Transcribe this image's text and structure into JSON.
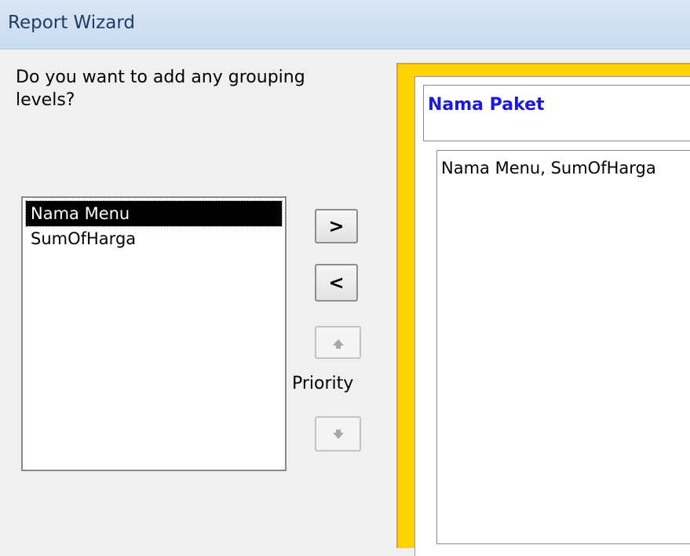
{
  "window": {
    "title": "Report Wizard"
  },
  "prompt": {
    "question": "Do you want to add any grouping levels?"
  },
  "fields": {
    "items": [
      "Nama Menu",
      "SumOfHarga"
    ],
    "selected_index": 0
  },
  "buttons": {
    "add_label": ">",
    "remove_label": "<",
    "up_icon": "arrow-up-icon",
    "down_icon": "arrow-down-icon"
  },
  "priority": {
    "label": "Priority"
  },
  "preview": {
    "group_level": "Nama Paket",
    "detail_fields": "Nama Menu, SumOfHarga"
  },
  "colors": {
    "title_bar": "#c9dcf0",
    "preview_frame": "#ffd400",
    "group_label": "#1a1adc"
  }
}
